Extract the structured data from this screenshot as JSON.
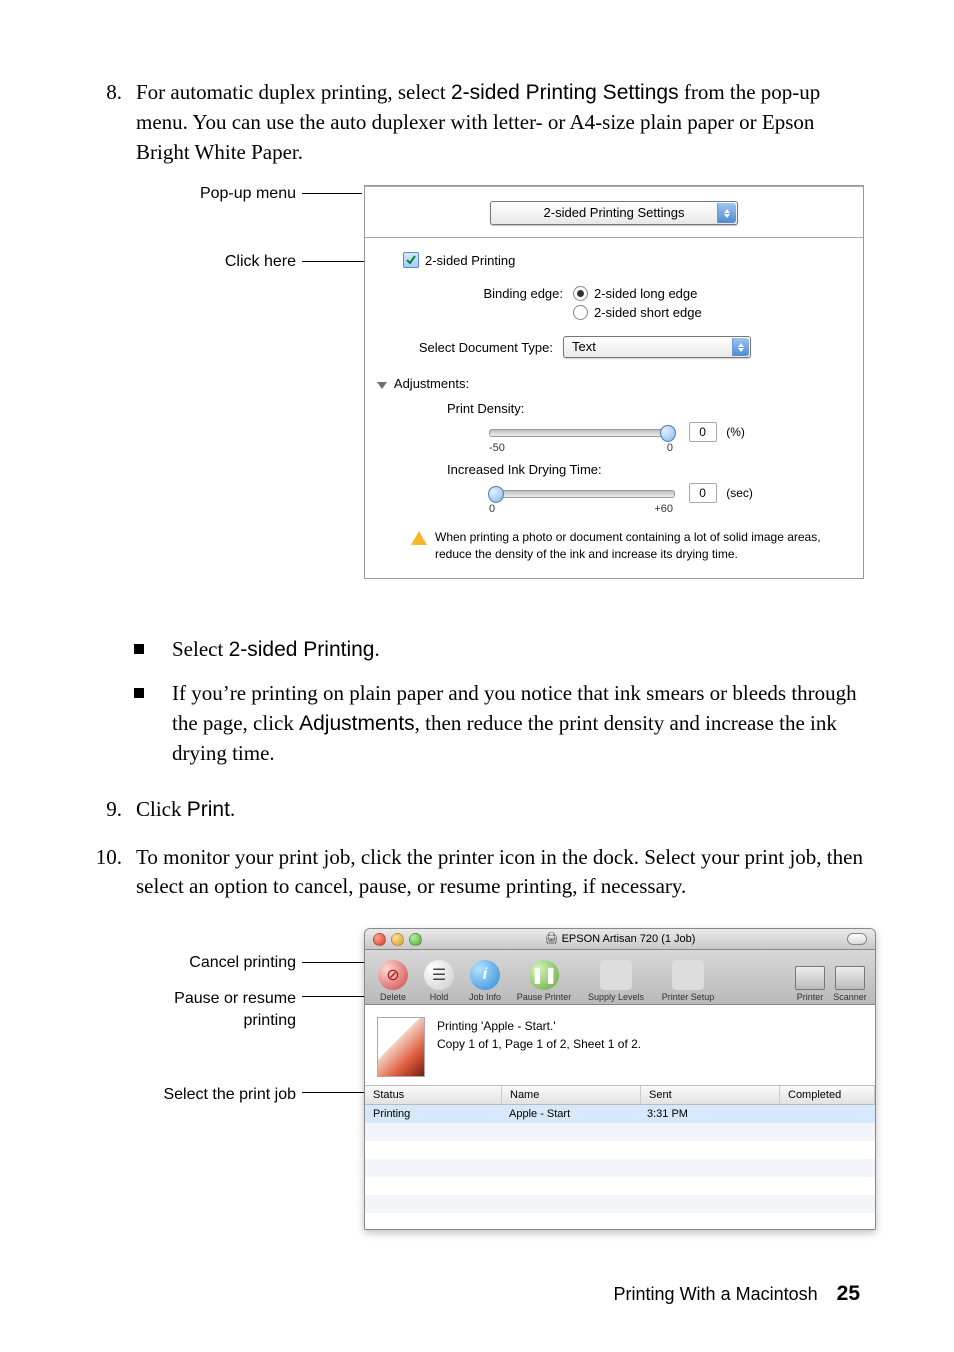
{
  "step8": {
    "num": "8.",
    "text_a": "For automatic duplex printing, select ",
    "text_b": "2-sided Printing Settings",
    "text_c": " from the pop-up menu. You can use the auto duplexer with letter- or A4-size plain paper or Epson Bright White Paper."
  },
  "fig1": {
    "callout_popup": "Pop-up menu",
    "callout_click": "Click here",
    "popup_value": "2-sided Printing Settings",
    "checkbox_label": "2-sided Printing",
    "binding_label": "Binding edge:",
    "radio_long": "2-sided long edge",
    "radio_short": "2-sided short edge",
    "doctype_label": "Select Document Type:",
    "doctype_value": "Text",
    "adjustments": "Adjustments:",
    "print_density_label": "Print Density:",
    "density_min": "-50",
    "density_max": "0",
    "density_value": "0",
    "density_unit": "(%)",
    "drying_label": "Increased Ink Drying Time:",
    "drying_min": "0",
    "drying_max": "+60",
    "drying_value": "0",
    "drying_unit": "(sec)",
    "warning": "When printing a photo or document containing a lot of solid image areas, reduce the density of the ink and increase its drying time."
  },
  "bullets": {
    "b1_a": "Select ",
    "b1_b": "2-sided Printing",
    "b1_c": ".",
    "b2_a": "If you’re printing on plain paper and you notice that ink smears or bleeds through the page, click ",
    "b2_b": "Adjustments",
    "b2_c": ", then reduce the print density and increase the ink drying time."
  },
  "step9": {
    "num": "9.",
    "a": "Click ",
    "b": "Print",
    "c": "."
  },
  "step10": {
    "num": "10.",
    "text": "To monitor your print job, click the printer icon in the dock. Select your print job, then select an option to cancel, pause, or resume printing, if necessary."
  },
  "fig2": {
    "callout_cancel": "Cancel printing",
    "callout_pause": "Pause or resume printing",
    "callout_select": "Select the print job",
    "title": "EPSON Artisan 720 (1 Job)",
    "tb_delete": "Delete",
    "tb_hold": "Hold",
    "tb_jobinfo": "Job Info",
    "tb_pause": "Pause Printer",
    "tb_supply": "Supply Levels",
    "tb_setup": "Printer Setup",
    "tb_printer": "Printer",
    "tb_scanner": "Scanner",
    "progress_line1": "Printing 'Apple - Start.'",
    "progress_line2": "Copy 1 of 1, Page 1 of 2, Sheet 1 of 2.",
    "head_status": "Status",
    "head_name": "Name",
    "head_sent": "Sent",
    "head_completed": "Completed",
    "row_status": "Printing",
    "row_name": "Apple - Start",
    "row_sent": "3:31 PM",
    "row_completed": ""
  },
  "footer": {
    "section": "Printing With a Macintosh",
    "page": "25"
  }
}
